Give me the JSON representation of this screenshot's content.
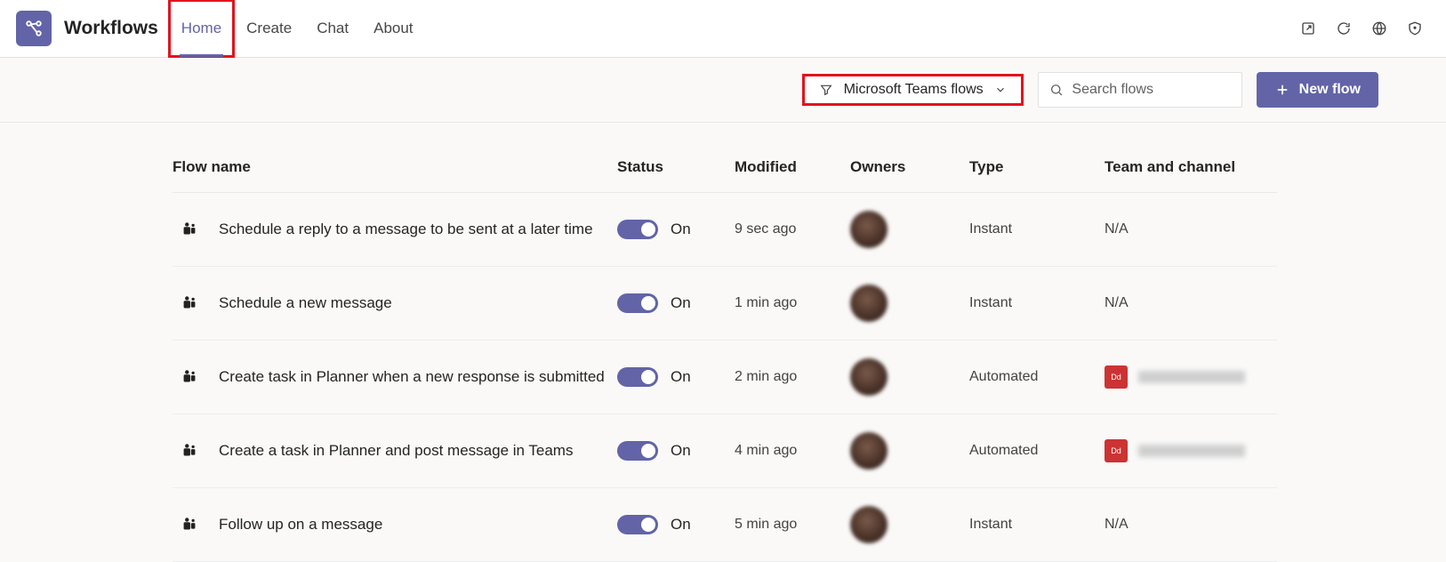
{
  "header": {
    "app_name": "Workflows",
    "tabs": [
      "Home",
      "Create",
      "Chat",
      "About"
    ],
    "active_tab": 0,
    "highlighted_tab": 0
  },
  "toolbar": {
    "filter_label": "Microsoft Teams flows",
    "filter_highlighted": true,
    "search_placeholder": "Search flows",
    "new_flow_label": "New flow"
  },
  "table": {
    "columns": [
      "Flow name",
      "Status",
      "Modified",
      "Owners",
      "Type",
      "Team and channel"
    ],
    "rows": [
      {
        "name": "Schedule a reply to a message to be sent at a later time",
        "status_on": true,
        "status_label": "On",
        "modified": "9 sec ago",
        "type": "Instant",
        "team_badge": null,
        "team": "N/A"
      },
      {
        "name": "Schedule a new message",
        "status_on": true,
        "status_label": "On",
        "modified": "1 min ago",
        "type": "Instant",
        "team_badge": null,
        "team": "N/A"
      },
      {
        "name": "Create task in Planner when a new response is submitted",
        "status_on": true,
        "status_label": "On",
        "modified": "2 min ago",
        "type": "Automated",
        "team_badge": "Dd",
        "team": ""
      },
      {
        "name": "Create a task in Planner and post message in Teams",
        "status_on": true,
        "status_label": "On",
        "modified": "4 min ago",
        "type": "Automated",
        "team_badge": "Dd",
        "team": ""
      },
      {
        "name": "Follow up on a message",
        "status_on": true,
        "status_label": "On",
        "modified": "5 min ago",
        "type": "Instant",
        "team_badge": null,
        "team": "N/A"
      }
    ]
  },
  "colors": {
    "accent": "#6264a7",
    "highlight": "#e3131c",
    "badge": "#cc3333"
  }
}
